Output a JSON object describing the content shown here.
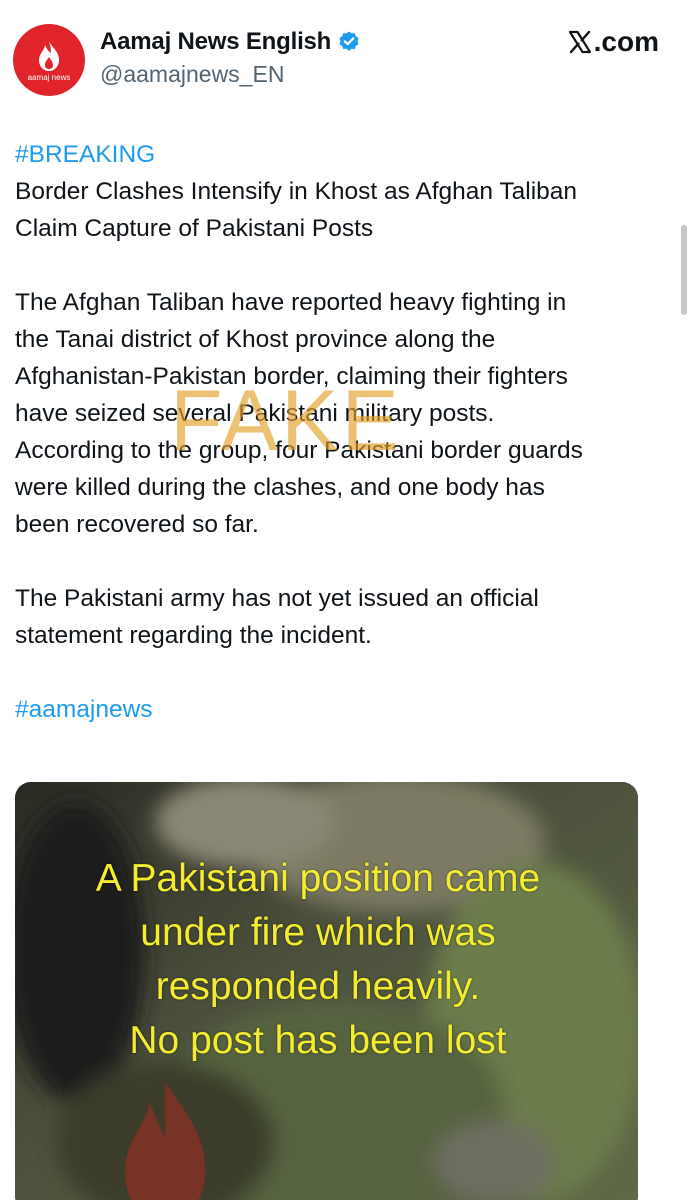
{
  "header": {
    "display_name": "Aamaj News English",
    "handle": "@aamajnews_EN",
    "site": ".com",
    "avatar_label": "aamaj news",
    "verified_icon": "verified-badge-icon",
    "colors": {
      "avatar_bg": "#e0242a",
      "verified": "#1d9bf0",
      "hashtag": "#1d9bf0"
    }
  },
  "tweet": {
    "tag": "#BREAKING",
    "headline_line1": "Border Clashes Intensify in Khost as Afghan Taliban",
    "headline_line2": "Claim Capture of Pakistani Posts",
    "body_lines": [
      "The Afghan Taliban have reported heavy fighting in",
      "the Tanai district of Khost province along the",
      "Afghanistan-Pakistan border, claiming their fighters",
      "have seized several Pakistani military posts.",
      "According to the group, four Pakistani border guards",
      "were killed during the clashes, and one body has",
      "been recovered so far."
    ],
    "statement_line1": "The Pakistani army has not yet issued an official",
    "statement_line2": "statement regarding the incident.",
    "footer_tag": "#aamajnews"
  },
  "watermark": "FAKE",
  "media_caption": {
    "lines": [
      "A Pakistani position came",
      "under fire which was",
      "responded heavily.",
      "No post has been lost"
    ],
    "color": "#f4ec2f"
  }
}
